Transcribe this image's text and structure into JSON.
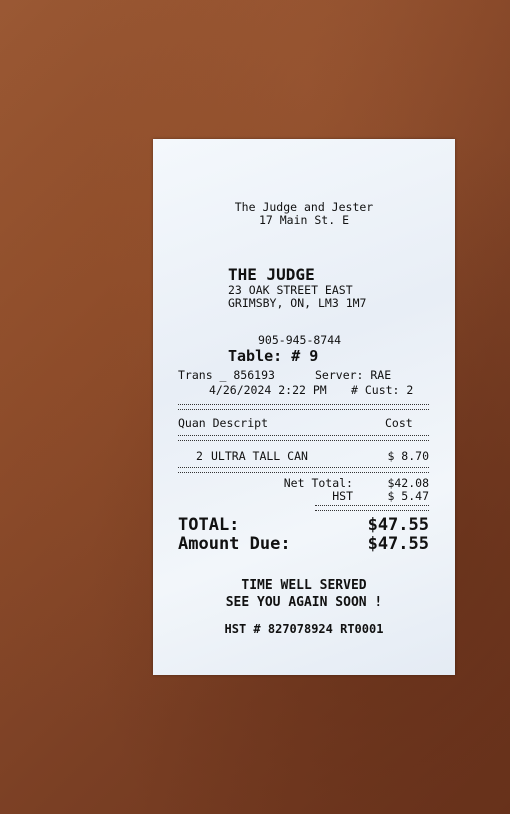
{
  "header": {
    "restaurant_name": "The Judge and Jester",
    "restaurant_address": "17 Main St. E",
    "brand": "THE JUDGE",
    "street": "23 OAK STREET EAST",
    "city": "GRIMSBY, ON, LM3 1M7",
    "phone": "905-945-8744"
  },
  "order": {
    "table": "Table: # 9",
    "trans": "Trans _ 856193",
    "server": "Server: RAE",
    "datetime": "4/26/2024 2:22 PM",
    "customers": "# Cust: 2"
  },
  "columns": {
    "quan_descript": "Quan Descript",
    "cost": "Cost"
  },
  "items": [
    {
      "quantity": "2",
      "description": "ULTRA TALL CAN",
      "cost": "$ 8.70"
    }
  ],
  "summary": {
    "net_total_label": "Net Total:",
    "net_total_value": "$42.08",
    "hst_label": "HST",
    "hst_value": "$ 5.47",
    "total_label": "TOTAL:",
    "total_value": "$47.55",
    "amount_due_label": "Amount Due:",
    "amount_due_value": "$47.55"
  },
  "footer": {
    "line1": "TIME WELL SERVED",
    "line2": "SEE YOU AGAIN SOON !",
    "hst_number": "HST # 827078924 RT0001"
  }
}
